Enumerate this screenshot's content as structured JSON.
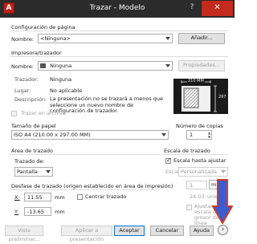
{
  "window": {
    "app_icon_letter": "A",
    "title": "Trazar - Modelo",
    "help_label": "?",
    "close_label": "✕"
  },
  "page_setup": {
    "section_label": "Configuración de página",
    "name_label": "Nombre:",
    "name_value": "<Ninguna>",
    "add_button": "Añadir..."
  },
  "printer": {
    "section_label": "Impresora/trazador",
    "name_label": "Nombre:",
    "name_value": "Ninguna",
    "properties_button": "Propiedades...",
    "plotter_label": "Trazador:",
    "plotter_value": "Ninguna",
    "location_label": "Lugar:",
    "location_value": "No aplicable",
    "description_label": "Descripción:",
    "description_value": "La presentación no se trazará a menos que seleccione un nuevo nombre de configuración de trazador.",
    "plot_to_file_label": "Trazar en archivo",
    "preview_dim_top": "210 MM",
    "preview_dim_side": "297"
  },
  "paper_size": {
    "section_label": "Tamaño de papel",
    "value": "ISO A4 (210.00 x 297.00 MM)"
  },
  "copies": {
    "section_label": "Número de copias",
    "value": "1"
  },
  "plot_area": {
    "section_label": "Área de trazado",
    "what_label": "Trazado de:",
    "what_value": "Pantalla"
  },
  "plot_scale": {
    "section_label": "Escala de trazado",
    "fit_label": "Escala hasta ajustar",
    "scale_label": "Escala:",
    "scale_value": "Personalizada",
    "value1": "1",
    "unit_value": "mm",
    "value2": "24.03",
    "unit2_label": "unidad",
    "lineweights_label": "Ajustar escala del grosor de línea"
  },
  "offset": {
    "section_label": "Desfase de trazado (origen establecido en área de impresión)",
    "x_label": "X:",
    "x_value": "11.55",
    "x_unit": "mm",
    "y_label": "Y:",
    "y_value": "-13.65",
    "y_unit": "mm",
    "center_label": "Centrar trazado"
  },
  "footer": {
    "preview_button": "Vista preliminar...",
    "apply_button": "Aplicar a presentación",
    "accept_button": "Aceptar",
    "cancel_button": "Cancelar",
    "help_button": "Ayuda",
    "expand_label": "›"
  },
  "colors": {
    "annotation_arrow": "#d23a2a",
    "annotation_arrow_fill": "#3b5bd1"
  }
}
